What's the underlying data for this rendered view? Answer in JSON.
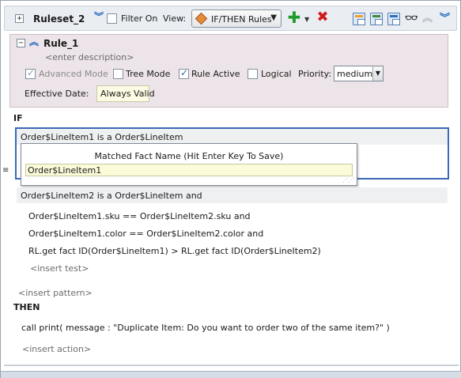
{
  "ruleset": {
    "expand_glyph": "+",
    "name": "Ruleset_2",
    "filter_label": "Filter On",
    "filter_checked": false,
    "view_label": "View:",
    "view_value": "IF/THEN Rules",
    "icons": [
      "expand-icon",
      "move-down-icon",
      "add-icon",
      "dropdown-icon",
      "delete-icon",
      "tree-icon",
      "copy-icon",
      "duplicate-icon",
      "glasses-icon",
      "move-up-icon",
      "move-down-icon"
    ]
  },
  "rule": {
    "collapse_glyph": "−",
    "name": "Rule_1",
    "description": "<enter description>",
    "advanced_mode_label": "Advanced Mode",
    "advanced_mode_checked": true,
    "tree_mode_label": "Tree Mode",
    "tree_mode_checked": false,
    "rule_active_label": "Rule Active",
    "rule_active_checked": true,
    "logical_label": "Logical",
    "logical_checked": false,
    "priority_label": "Priority:",
    "priority_value": "medium",
    "effective_date_label": "Effective Date:",
    "effective_date_value": "Always Valid"
  },
  "if_section": {
    "label": "IF",
    "pattern1": "Order$LineItem1 is a Order$LineItem",
    "side_mark": "≡",
    "popup_title": "Matched Fact Name (Hit Enter Key To Save)",
    "popup_value": "Order$LineItem1",
    "pattern2": "Order$LineItem2 is a Order$LineItem  and",
    "tests": [
      "Order$LineItem1.sku  ==  Order$LineItem2.sku and",
      "Order$LineItem1.color  ==  Order$LineItem2.color and",
      "RL.get fact ID(Order$LineItem1)  >  RL.get fact ID(Order$LineItem2)"
    ],
    "insert_test": "<insert test>",
    "insert_pattern": "<insert pattern>"
  },
  "then_section": {
    "label": "THEN",
    "action": "call print( message : \"Duplicate Item: Do you want to order two of the same item?\" )",
    "insert_action": "<insert action>"
  }
}
